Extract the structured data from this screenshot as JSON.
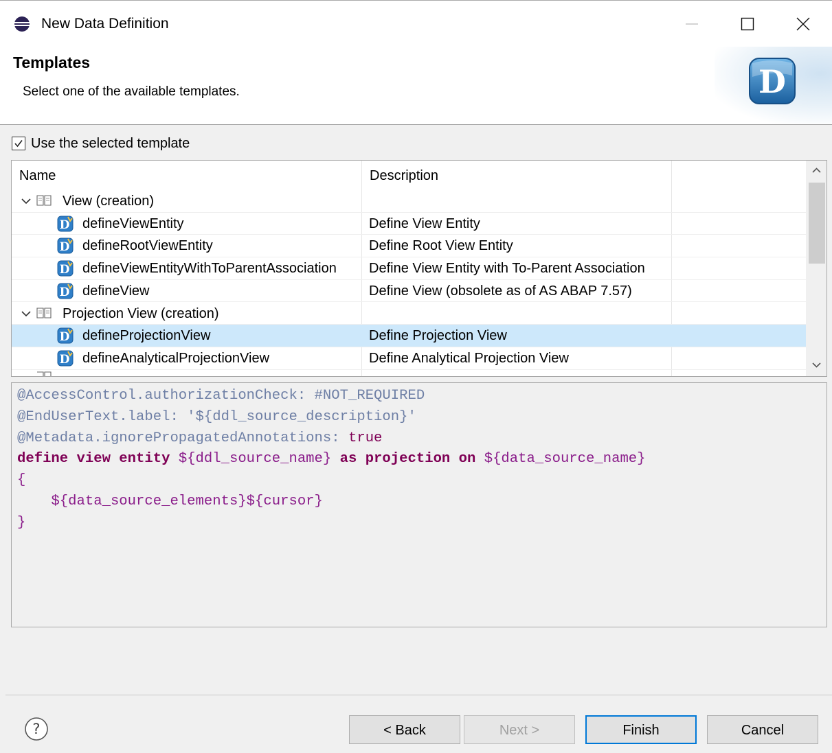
{
  "window": {
    "title": "New Data Definition",
    "controls": [
      "minimize",
      "maximize",
      "close"
    ]
  },
  "banner": {
    "heading": "Templates",
    "description": "Select one of the available templates.",
    "logo_letter": "D"
  },
  "use_template": {
    "label": "Use the selected template",
    "checked": true
  },
  "templates_table": {
    "columns": [
      "Name",
      "Description"
    ],
    "rows": [
      {
        "type": "group",
        "name": "View (creation)",
        "expanded": true
      },
      {
        "type": "template",
        "name": "defineViewEntity",
        "description": "Define View Entity"
      },
      {
        "type": "template",
        "name": "defineRootViewEntity",
        "description": "Define Root View Entity"
      },
      {
        "type": "template",
        "name": "defineViewEntityWithToParentAssociation",
        "description": "Define View Entity with To-Parent Association"
      },
      {
        "type": "template",
        "name": "defineView",
        "description": "Define View (obsolete as of AS ABAP 7.57)"
      },
      {
        "type": "group",
        "name": "Projection View (creation)",
        "expanded": true
      },
      {
        "type": "template",
        "name": "defineProjectionView",
        "description": "Define Projection View",
        "selected": true
      },
      {
        "type": "template",
        "name": "defineAnalyticalProjectionView",
        "description": "Define Analytical Projection View"
      }
    ]
  },
  "preview": {
    "lines": [
      "@AccessControl.authorizationCheck: #NOT_REQUIRED",
      "@EndUserText.label: '${ddl_source_description}'",
      "@Metadata.ignorePropagatedAnnotations: true",
      "define view entity ${ddl_source_name} as projection on ${data_source_name}",
      "{",
      "    ${data_source_elements}${cursor}",
      "}"
    ]
  },
  "buttons": {
    "back": "< Back",
    "next": "Next >",
    "finish": "Finish",
    "cancel": "Cancel"
  },
  "colors": {
    "selection": "#cde8fb",
    "keyword": "#7f0055",
    "annotation": "#6e7fa5",
    "default_button_border": "#0078d7"
  }
}
